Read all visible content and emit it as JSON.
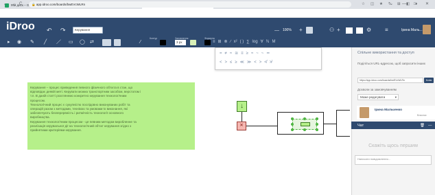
{
  "browser": {
    "tabs": [
      {
        "title": "Мій диск – Google Диск",
        "favicon_color": "#1fa463"
      },
      {
        "title": "Перегляд версії MTW - iD1 - Go...",
        "favicon_color": "#f4b400"
      },
      {
        "title": "Керування - iDroo",
        "favicon_color": "#2f4a6f"
      }
    ],
    "new_tab": "+",
    "window_controls": [
      "⌄",
      "—",
      "□",
      "✕"
    ],
    "nav": {
      "back": "←",
      "forward": "→",
      "reload": "C"
    },
    "url": "app.idroo.com/boards/bwEVcWLRn",
    "extensions": [
      "☆",
      "◫",
      "★",
      "↻",
      "⊞",
      "◧",
      "●"
    ]
  },
  "app": {
    "logo": "iDroo",
    "document_name": "Керування",
    "zoom": "100%",
    "user_short": "Ірина Маль...",
    "header_icons": {
      "undo": "↶",
      "redo": "↷",
      "plus": "+",
      "minus": "—",
      "gear": "⚙",
      "menu": "≡",
      "people": "⚇"
    }
  },
  "toolbar": {
    "group_labels": {
      "outline": "Контур",
      "fill": "Заповнення",
      "formula": "Формула"
    },
    "tools": [
      "▸",
      "◉",
      "✎",
      "╱",
      "／",
      "▭",
      "◯",
      "⇄"
    ],
    "font_size": "3 px",
    "colors": {
      "outline": "#d8f0b8",
      "fill": "#000000",
      "accent": "#2f4a6f",
      "canvas_note": "#b6f08a",
      "red_node": "#f5b6b0"
    }
  },
  "math_panel": {
    "row1": [
      "≡",
      "⊞",
      "⊗",
      "∕",
      "x²",
      "( )",
      "∑",
      "log",
      "∀",
      "ℕ",
      "M"
    ],
    "row2": [
      "=",
      "≠",
      "≈",
      "≅",
      "≡",
      "≥",
      "≈",
      "~",
      "~",
      "≃"
    ],
    "row3": [
      "<",
      ">",
      "≤",
      "≥",
      "≪",
      "≫",
      "<",
      ">",
      "≮",
      "≯"
    ]
  },
  "canvas": {
    "note_lines": [
      "Керування – процес приведення певного фізичного об'єкта в стан, що",
      "відповідає деякій меті. Керувати можна транспортним засобом, верстатом і",
      "т.п. В даній статті розглянемо конкретно керування технологічним",
      "процесом.",
      "Технологічний процес є сукупністю послідовно виконуваних робіт та",
      "операцій разом з методами, технікою та умовами їх виконання, які",
      "забезпечують безперервність і ритмічність технології основного",
      "виробництва.",
      "Керування технологічним процесом - це певним методом виробленне та",
      "реалізація керувальної дії на технологічний об'єкт керування згідно з",
      "прийнятими критеріями керування."
    ],
    "node_down": "↓",
    "node_x": "✕"
  },
  "share_panel": {
    "title": "Спільне використання та доступ",
    "url_hint": "Поділіться URL-адресою, щоб запросити інших",
    "url_value": "https://app.idroo.com/boards/bwEVcWLRn",
    "copy_button": "Копія",
    "default_label": "Дозволи за замовчуванням",
    "permission": "Може редагувати",
    "user_name": "Ірина Мальченко",
    "user_role": "Власник"
  },
  "chat": {
    "title": "Чат",
    "icons": [
      "🗑",
      "—"
    ],
    "empty_text": "Скажіть щось першим",
    "input_placeholder": "Написати повідомлення..."
  }
}
